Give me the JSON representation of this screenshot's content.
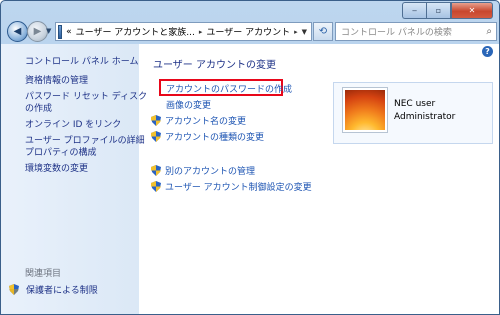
{
  "window": {
    "minimize_glyph": "‒",
    "maximize_glyph": "▫",
    "close_glyph": "✕"
  },
  "nav": {
    "back_glyph": "◀",
    "forward_glyph": "▶",
    "address_prefix": "«",
    "breadcrumb": [
      "ユーザー アカウントと家族...",
      "ユーザー アカウント"
    ],
    "crumb_separator": "▸",
    "search_placeholder": "コントロール パネルの検索"
  },
  "sidebar": {
    "home": "コントロール パネル ホーム",
    "tasks": [
      "資格情報の管理",
      "パスワード リセット ディスク",
      "の作成",
      "オンライン ID をリンク",
      "ユーザー プロファイルの詳細",
      "プロパティの構成",
      "環境変数の変更"
    ],
    "related_title": "関連項目",
    "related_link": "保護者による制限"
  },
  "main": {
    "heading": "ユーザー アカウントの変更",
    "links": [
      "アカウントのパスワードの作成",
      "画像の変更",
      "アカウント名の変更",
      "アカウントの種類の変更"
    ],
    "other_links": [
      "別のアカウントの管理",
      "ユーザー アカウント制御設定の変更"
    ]
  },
  "user": {
    "name": "NEC user",
    "role": "Administrator"
  },
  "colors": {
    "link": "#1e55b3",
    "highlight": "#e8071a",
    "sidebar_bg": "#dbe8f6"
  }
}
